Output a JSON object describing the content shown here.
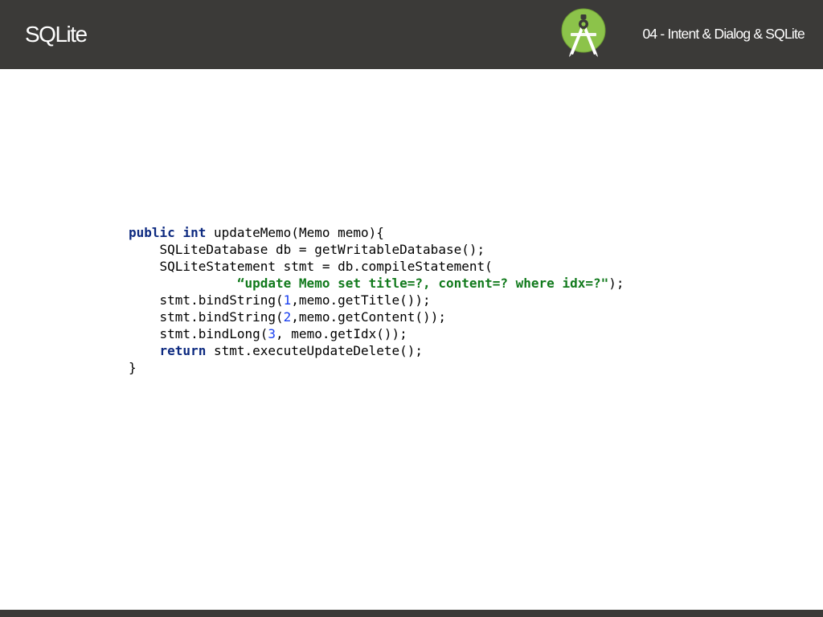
{
  "header": {
    "title": "SQLite",
    "subtitle": "04 - Intent & Dialog & SQLite",
    "logo_icon": "android-studio-icon"
  },
  "colors": {
    "header_bg": "#3b3a38",
    "keyword": "#0d2a80",
    "number": "#1a40f0",
    "string": "#117a1c"
  },
  "code": {
    "lines": [
      [
        {
          "t": "kw",
          "v": "public"
        },
        {
          "t": "plain",
          "v": " "
        },
        {
          "t": "kw",
          "v": "int"
        },
        {
          "t": "plain",
          "v": " updateMemo(Memo memo){"
        }
      ],
      [
        {
          "t": "plain",
          "v": "    SQLiteDatabase db = getWritableDatabase();"
        }
      ],
      [
        {
          "t": "plain",
          "v": "    SQLiteStatement stmt = db.compileStatement("
        }
      ],
      [
        {
          "t": "plain",
          "v": "              "
        },
        {
          "t": "str",
          "v": "“update Memo set title=?, content=? where idx=?\""
        },
        {
          "t": "plain",
          "v": ");"
        }
      ],
      [
        {
          "t": "plain",
          "v": "    stmt.bindString("
        },
        {
          "t": "num",
          "v": "1"
        },
        {
          "t": "plain",
          "v": ",memo.getTitle());"
        }
      ],
      [
        {
          "t": "plain",
          "v": "    stmt.bindString("
        },
        {
          "t": "num",
          "v": "2"
        },
        {
          "t": "plain",
          "v": ",memo.getContent());"
        }
      ],
      [
        {
          "t": "plain",
          "v": "    stmt.bindLong("
        },
        {
          "t": "num",
          "v": "3"
        },
        {
          "t": "plain",
          "v": ", memo.getIdx());"
        }
      ],
      [
        {
          "t": "plain",
          "v": "    "
        },
        {
          "t": "kw",
          "v": "return"
        },
        {
          "t": "plain",
          "v": " stmt.executeUpdateDelete();"
        }
      ],
      [
        {
          "t": "plain",
          "v": "}"
        }
      ]
    ]
  }
}
